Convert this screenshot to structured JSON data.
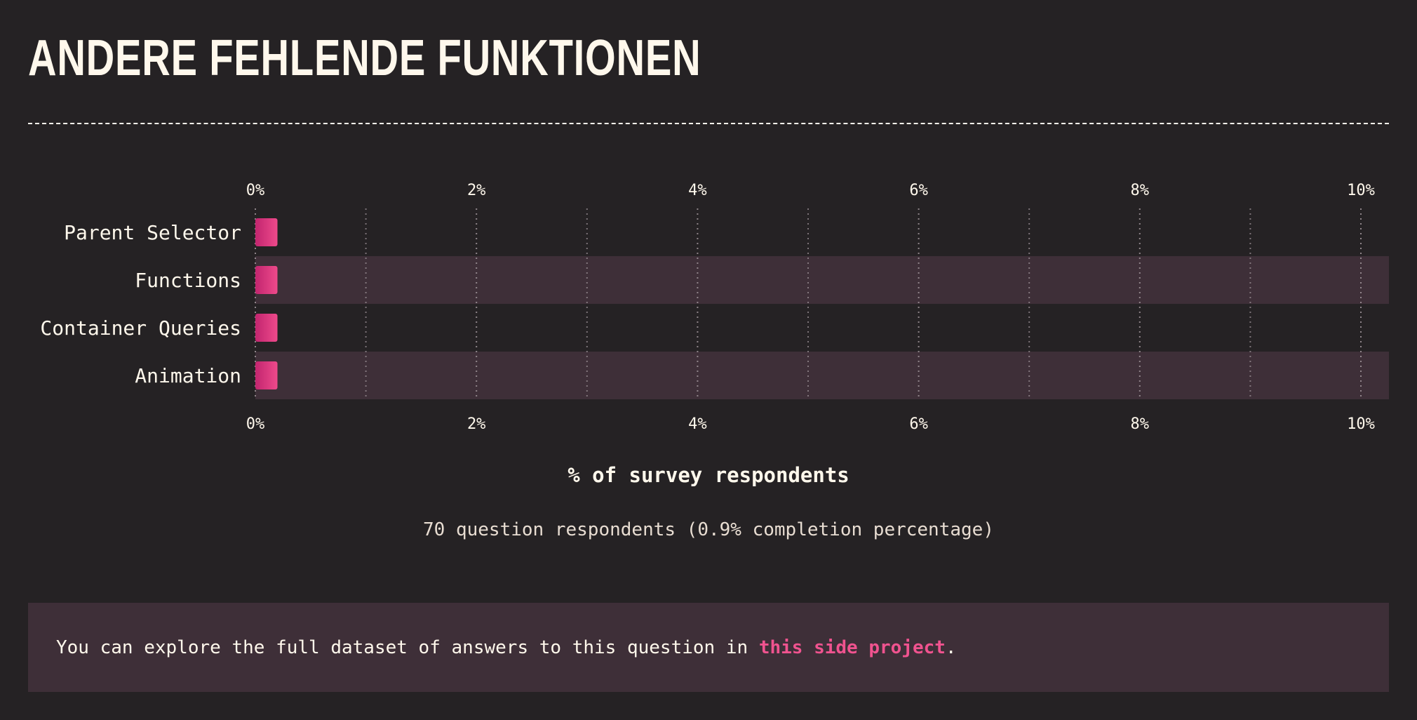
{
  "page": {
    "title": "ANDERE FEHLENDE FUNKTIONEN",
    "respondents_note": "70 question respondents (0.9% completion percentage)",
    "info": {
      "text_before": "You can explore the full dataset of answers to this question in ",
      "link_text": "this side project",
      "text_after": "."
    }
  },
  "chart_data": {
    "type": "bar",
    "orientation": "horizontal",
    "categories": [
      "Parent Selector",
      "Functions",
      "Container Queries",
      "Animation"
    ],
    "values": [
      0.2,
      0.2,
      0.2,
      0.2
    ],
    "xlim": [
      0,
      10
    ],
    "xticks": [
      0,
      2,
      4,
      6,
      8,
      10
    ],
    "tick_labels": [
      "0%",
      "2%",
      "4%",
      "6%",
      "8%",
      "10%"
    ],
    "xlabel": "% of survey respondents",
    "grid": true,
    "colors": {
      "bar_start": "#c2256f",
      "bar_end": "#ee4a8b",
      "row_band": "#3e2f38",
      "background": "#252224",
      "text": "#fff8ec"
    }
  }
}
